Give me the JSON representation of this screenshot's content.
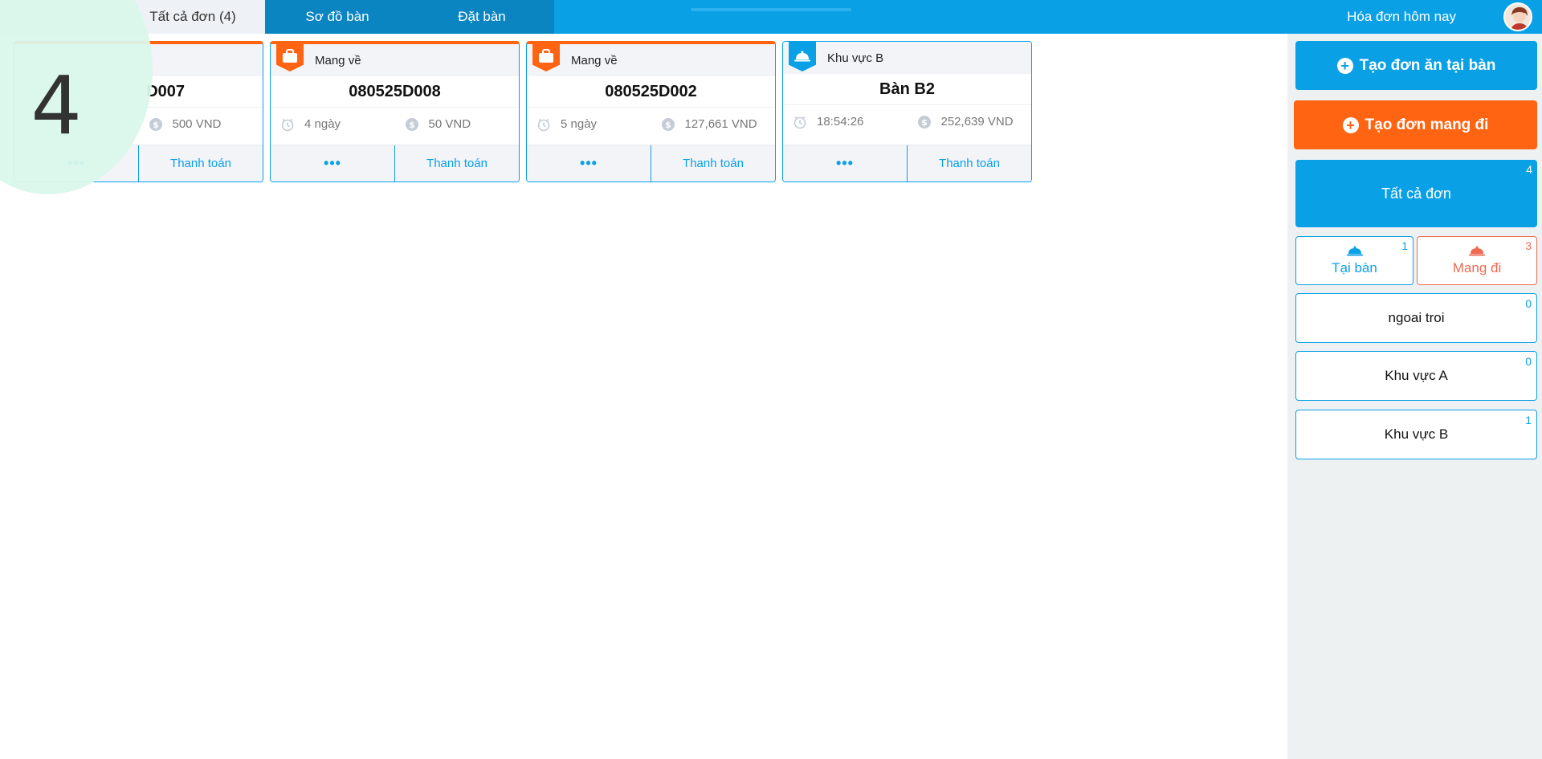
{
  "topbar": {
    "tabs": [
      {
        "label": "Tất cả đơn (4)"
      },
      {
        "label": "Sơ đồ bàn"
      },
      {
        "label": "Đặt bàn"
      }
    ],
    "right_title": "Hóa đơn hôm nay"
  },
  "step_number": "4",
  "orders": [
    {
      "type_label": "",
      "code": "D007",
      "time": "",
      "amount": "500 VND",
      "more": "•••",
      "pay": "Thanh toán"
    },
    {
      "type_label": "Mang về",
      "code": "080525D008",
      "time": "4 ngày",
      "amount": "50 VND",
      "more": "•••",
      "pay": "Thanh toán"
    },
    {
      "type_label": "Mang về",
      "code": "080525D002",
      "time": "5 ngày",
      "amount": "127,661 VND",
      "more": "•••",
      "pay": "Thanh toán"
    },
    {
      "type_label": "Khu vực B",
      "code": "Bàn B2",
      "time": "18:54:26",
      "amount": "252,639 VND",
      "more": "•••",
      "pay": "Thanh toán"
    }
  ],
  "sidebar": {
    "create_dinein": "Tạo đơn ăn tại bàn",
    "create_takeaway": "Tạo đơn mang đi",
    "all_orders": {
      "label": "Tất cả đơn",
      "count": "4"
    },
    "dinein": {
      "label": "Tại bàn",
      "count": "1"
    },
    "takeaway": {
      "label": "Mang đi",
      "count": "3"
    },
    "areas": [
      {
        "label": "ngoai troi",
        "count": "0"
      },
      {
        "label": "Khu vực A",
        "count": "0"
      },
      {
        "label": "Khu vực B",
        "count": "1"
      }
    ]
  },
  "colors": {
    "primary": "#0aa0e6",
    "takeaway": "#ff6412",
    "takeaway_light": "#ef6a52",
    "tab_dark": "#0b84c2",
    "sidebar_bg": "#eef1f2"
  }
}
